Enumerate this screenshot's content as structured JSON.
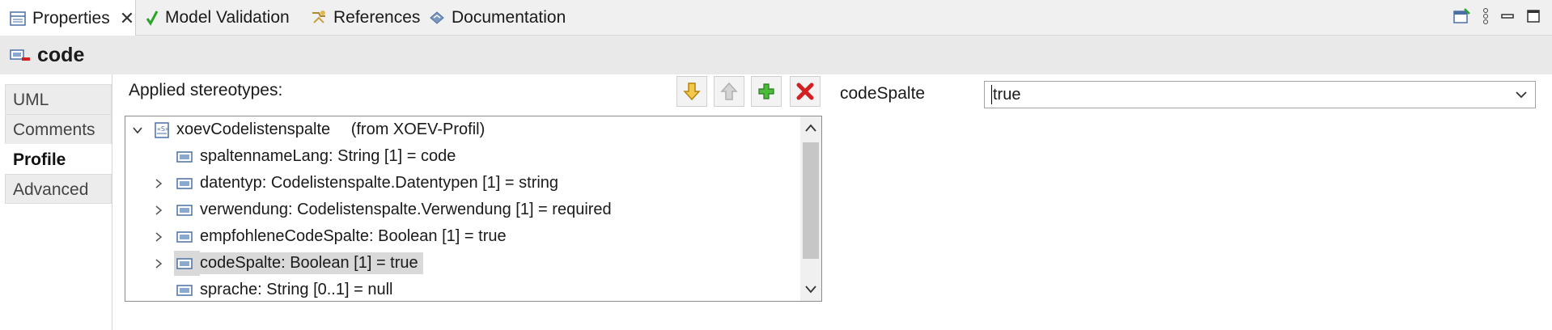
{
  "tabs": [
    {
      "label": "Properties",
      "icon": "properties-icon",
      "active": true
    },
    {
      "label": "Model Validation",
      "icon": "checkmark-icon"
    },
    {
      "label": "References",
      "icon": "references-icon"
    },
    {
      "label": "Documentation",
      "icon": "documentation-icon"
    }
  ],
  "element": {
    "title": "code",
    "icon": "property-icon"
  },
  "side_tabs": [
    "UML",
    "Comments",
    "Profile",
    "Advanced"
  ],
  "active_side_tab": "Profile",
  "stereotypes": {
    "label": "Applied stereotypes:",
    "root": {
      "name": "xoevCodelistenspalte",
      "from": "(from XOEV-Profil)"
    },
    "items": [
      {
        "text": "spaltennameLang: String [1] = code",
        "expandable": false
      },
      {
        "text": "datentyp: Codelistenspalte.Datentypen [1] = string",
        "expandable": true
      },
      {
        "text": "verwendung: Codelistenspalte.Verwendung [1] = required",
        "expandable": true
      },
      {
        "text": "empfohleneCodeSpalte: Boolean [1] = true",
        "expandable": true
      },
      {
        "text": "codeSpalte: Boolean [1] = true",
        "expandable": true,
        "selected": true
      },
      {
        "text": "sprache: String [0..1] = null",
        "expandable": false
      }
    ],
    "buttons": [
      "move-down",
      "move-up",
      "add",
      "remove"
    ]
  },
  "property": {
    "label": "codeSpalte",
    "value": "true"
  },
  "colors": {
    "accent_green": "#2aa52a",
    "remove_red": "#d42020",
    "arrow_yellow": "#e8b020"
  }
}
